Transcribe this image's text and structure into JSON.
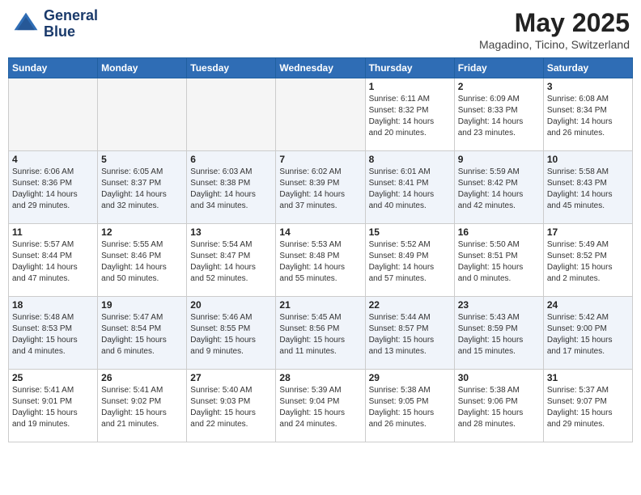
{
  "header": {
    "logo_line1": "General",
    "logo_line2": "Blue",
    "month": "May 2025",
    "location": "Magadino, Ticino, Switzerland"
  },
  "weekdays": [
    "Sunday",
    "Monday",
    "Tuesday",
    "Wednesday",
    "Thursday",
    "Friday",
    "Saturday"
  ],
  "weeks": [
    [
      {
        "day": "",
        "info": ""
      },
      {
        "day": "",
        "info": ""
      },
      {
        "day": "",
        "info": ""
      },
      {
        "day": "",
        "info": ""
      },
      {
        "day": "1",
        "info": "Sunrise: 6:11 AM\nSunset: 8:32 PM\nDaylight: 14 hours\nand 20 minutes."
      },
      {
        "day": "2",
        "info": "Sunrise: 6:09 AM\nSunset: 8:33 PM\nDaylight: 14 hours\nand 23 minutes."
      },
      {
        "day": "3",
        "info": "Sunrise: 6:08 AM\nSunset: 8:34 PM\nDaylight: 14 hours\nand 26 minutes."
      }
    ],
    [
      {
        "day": "4",
        "info": "Sunrise: 6:06 AM\nSunset: 8:36 PM\nDaylight: 14 hours\nand 29 minutes."
      },
      {
        "day": "5",
        "info": "Sunrise: 6:05 AM\nSunset: 8:37 PM\nDaylight: 14 hours\nand 32 minutes."
      },
      {
        "day": "6",
        "info": "Sunrise: 6:03 AM\nSunset: 8:38 PM\nDaylight: 14 hours\nand 34 minutes."
      },
      {
        "day": "7",
        "info": "Sunrise: 6:02 AM\nSunset: 8:39 PM\nDaylight: 14 hours\nand 37 minutes."
      },
      {
        "day": "8",
        "info": "Sunrise: 6:01 AM\nSunset: 8:41 PM\nDaylight: 14 hours\nand 40 minutes."
      },
      {
        "day": "9",
        "info": "Sunrise: 5:59 AM\nSunset: 8:42 PM\nDaylight: 14 hours\nand 42 minutes."
      },
      {
        "day": "10",
        "info": "Sunrise: 5:58 AM\nSunset: 8:43 PM\nDaylight: 14 hours\nand 45 minutes."
      }
    ],
    [
      {
        "day": "11",
        "info": "Sunrise: 5:57 AM\nSunset: 8:44 PM\nDaylight: 14 hours\nand 47 minutes."
      },
      {
        "day": "12",
        "info": "Sunrise: 5:55 AM\nSunset: 8:46 PM\nDaylight: 14 hours\nand 50 minutes."
      },
      {
        "day": "13",
        "info": "Sunrise: 5:54 AM\nSunset: 8:47 PM\nDaylight: 14 hours\nand 52 minutes."
      },
      {
        "day": "14",
        "info": "Sunrise: 5:53 AM\nSunset: 8:48 PM\nDaylight: 14 hours\nand 55 minutes."
      },
      {
        "day": "15",
        "info": "Sunrise: 5:52 AM\nSunset: 8:49 PM\nDaylight: 14 hours\nand 57 minutes."
      },
      {
        "day": "16",
        "info": "Sunrise: 5:50 AM\nSunset: 8:51 PM\nDaylight: 15 hours\nand 0 minutes."
      },
      {
        "day": "17",
        "info": "Sunrise: 5:49 AM\nSunset: 8:52 PM\nDaylight: 15 hours\nand 2 minutes."
      }
    ],
    [
      {
        "day": "18",
        "info": "Sunrise: 5:48 AM\nSunset: 8:53 PM\nDaylight: 15 hours\nand 4 minutes."
      },
      {
        "day": "19",
        "info": "Sunrise: 5:47 AM\nSunset: 8:54 PM\nDaylight: 15 hours\nand 6 minutes."
      },
      {
        "day": "20",
        "info": "Sunrise: 5:46 AM\nSunset: 8:55 PM\nDaylight: 15 hours\nand 9 minutes."
      },
      {
        "day": "21",
        "info": "Sunrise: 5:45 AM\nSunset: 8:56 PM\nDaylight: 15 hours\nand 11 minutes."
      },
      {
        "day": "22",
        "info": "Sunrise: 5:44 AM\nSunset: 8:57 PM\nDaylight: 15 hours\nand 13 minutes."
      },
      {
        "day": "23",
        "info": "Sunrise: 5:43 AM\nSunset: 8:59 PM\nDaylight: 15 hours\nand 15 minutes."
      },
      {
        "day": "24",
        "info": "Sunrise: 5:42 AM\nSunset: 9:00 PM\nDaylight: 15 hours\nand 17 minutes."
      }
    ],
    [
      {
        "day": "25",
        "info": "Sunrise: 5:41 AM\nSunset: 9:01 PM\nDaylight: 15 hours\nand 19 minutes."
      },
      {
        "day": "26",
        "info": "Sunrise: 5:41 AM\nSunset: 9:02 PM\nDaylight: 15 hours\nand 21 minutes."
      },
      {
        "day": "27",
        "info": "Sunrise: 5:40 AM\nSunset: 9:03 PM\nDaylight: 15 hours\nand 22 minutes."
      },
      {
        "day": "28",
        "info": "Sunrise: 5:39 AM\nSunset: 9:04 PM\nDaylight: 15 hours\nand 24 minutes."
      },
      {
        "day": "29",
        "info": "Sunrise: 5:38 AM\nSunset: 9:05 PM\nDaylight: 15 hours\nand 26 minutes."
      },
      {
        "day": "30",
        "info": "Sunrise: 5:38 AM\nSunset: 9:06 PM\nDaylight: 15 hours\nand 28 minutes."
      },
      {
        "day": "31",
        "info": "Sunrise: 5:37 AM\nSunset: 9:07 PM\nDaylight: 15 hours\nand 29 minutes."
      }
    ]
  ]
}
